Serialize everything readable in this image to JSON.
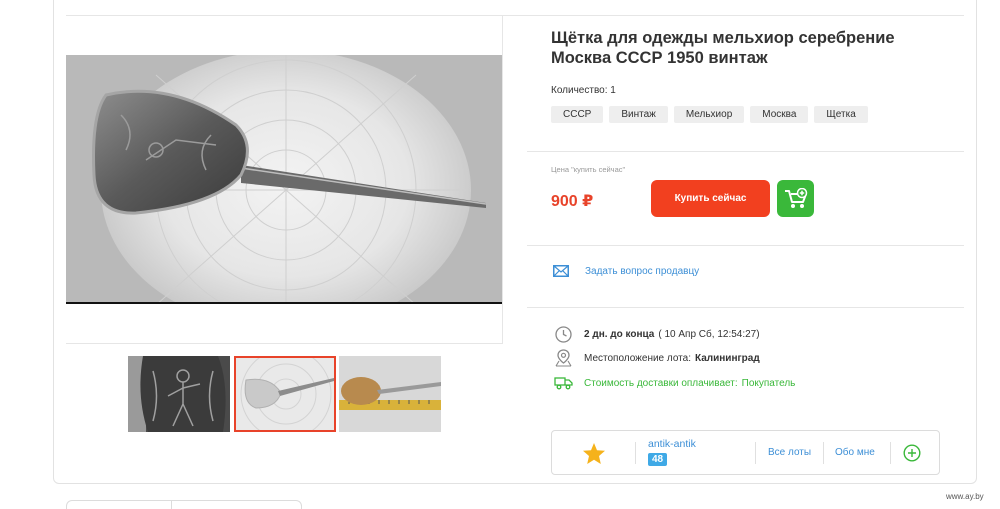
{
  "product": {
    "title": "Щётка для одежды мельхиор серебрение Москва СССР 1950 винтаж",
    "quantity": "Количество: 1",
    "tags": [
      "СССР",
      "Винтаж",
      "Мельхиор",
      "Москва",
      "Щетка"
    ]
  },
  "purchase": {
    "price_label": "Цена \"купить сейчас\"",
    "price": "900 ₽",
    "buy_label": "Купить сейчас",
    "cart_icon": "cart-add-icon"
  },
  "ask": {
    "label": "Задать вопрос продавцу",
    "icon": "envelope-icon"
  },
  "details": {
    "time_left": "2 дн. до конца",
    "end_date": "( 10 Апр Сб, 12:54:27)",
    "location_label": "Местоположение лота:",
    "location_value": "Калининград",
    "delivery_label": "Стоимость доставки оплачивает:",
    "delivery_value": "Покупатель"
  },
  "seller": {
    "name": "antik-antik",
    "rating": "48",
    "all_lots": "Все лоты",
    "about": "Обо мне"
  },
  "watermark": "www.ay.by",
  "colors": {
    "accent": "#f2401f",
    "green": "#3ab83a",
    "link": "#3d8fd6",
    "badge": "#3fa9e6"
  }
}
